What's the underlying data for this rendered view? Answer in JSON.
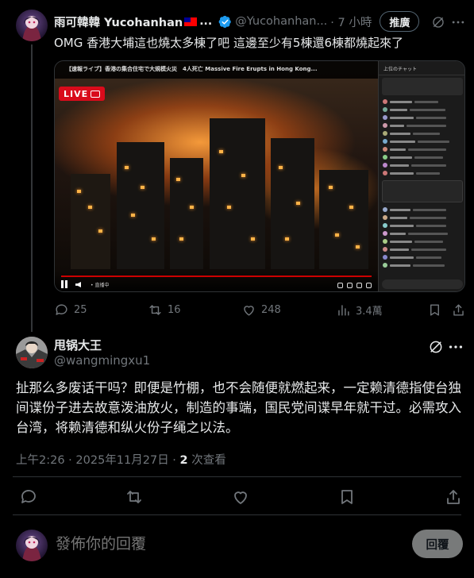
{
  "parent_tweet": {
    "author_name": "雨可韓韓 Yucohanhan",
    "name_truncation": "...",
    "handle": "@Yucohanhan...",
    "time": "· 7 小時",
    "recommend_label": "推廣",
    "text": "OMG 香港大埔這也燒太多棟了吧 這邊至少有5棟還6棟都燒起來了",
    "video": {
      "title": "【速報ライブ】香港の集合住宅で大規模火災　4人死亡 Massive Fire Erupts in Hong Kong...",
      "live_label": "LIVE",
      "chat_header": "上位のチャット",
      "controls_label": "• 直播中"
    },
    "stats": {
      "replies": "25",
      "reposts": "16",
      "likes": "248",
      "views": "3.4萬"
    }
  },
  "main_tweet": {
    "author_name": "甩锅大王",
    "handle": "@wangmingxu1",
    "text": "扯那么多废话干吗？即便是竹棚，也不会随便就燃起来，一定赖清德指使台独间谍份子进去故意泼油放火，制造的事端，国民党间谍早年就干过。必需攻入台湾，将赖清德和纵火份子绳之以法。",
    "timestamp": "上午2:26 · 2025年11月27日 · ",
    "views_count": "2",
    "views_label": " 次查看"
  },
  "reply_composer": {
    "placeholder": "發佈你的回覆",
    "button_label": "回覆"
  },
  "colors": {
    "background": "#000000",
    "text_primary": "#e7e9ea",
    "text_secondary": "#71767b",
    "verified_blue": "#1d9bf0",
    "live_red": "#d90b1b",
    "reply_button": "#787a7a"
  }
}
